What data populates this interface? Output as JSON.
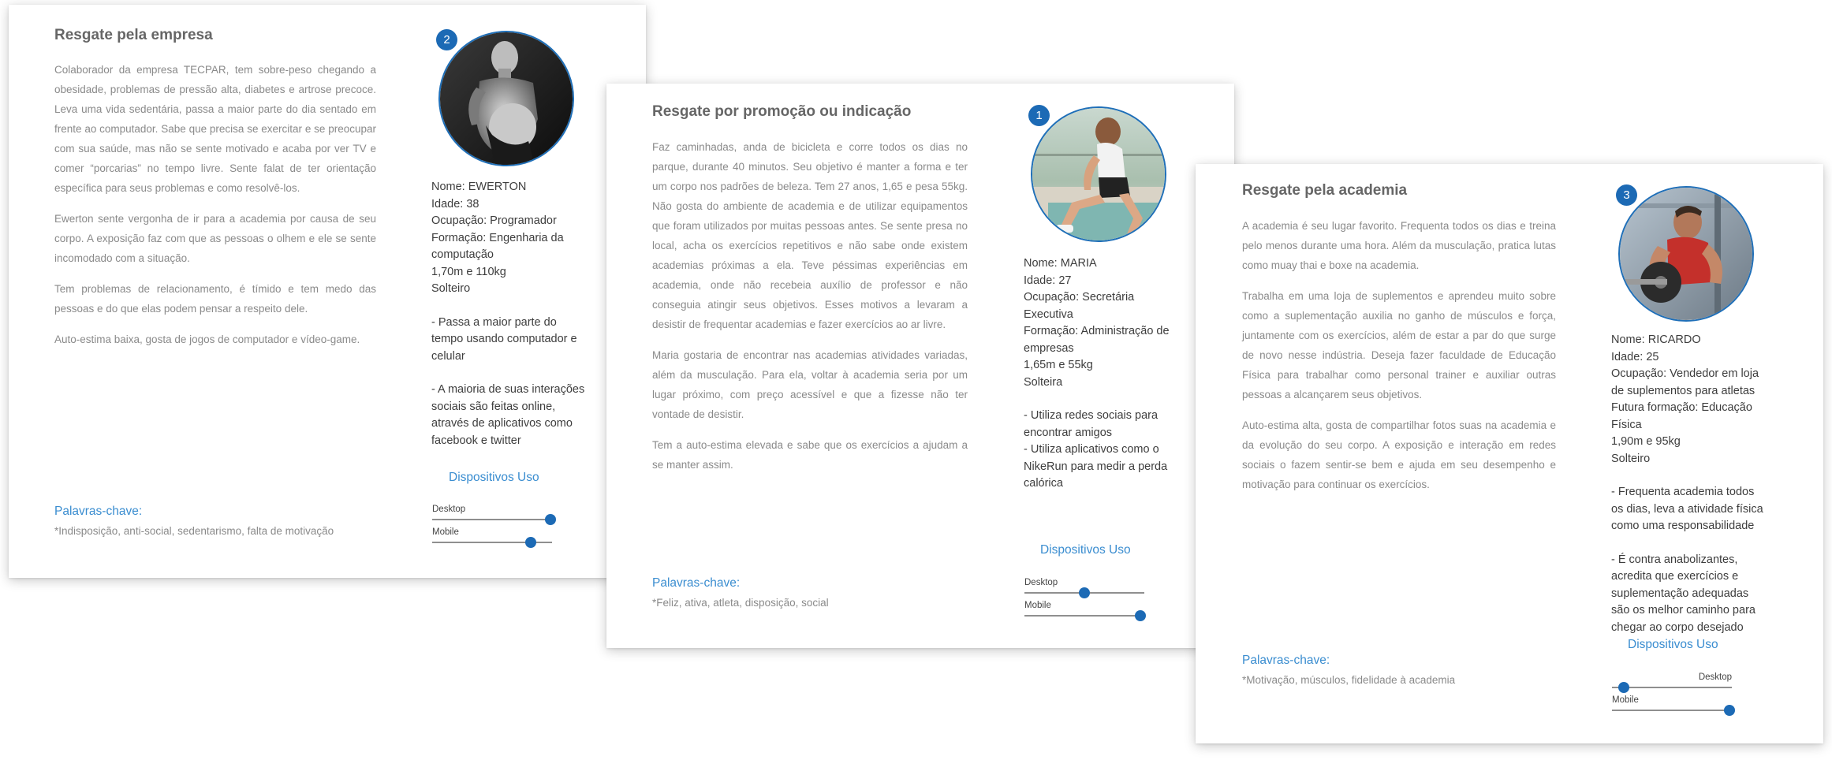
{
  "cards": [
    {
      "badge": "2",
      "title": "Resgate pela empresa",
      "paragraphs": [
        "Colaborador da empresa TECPAR, tem sobre-peso chegando a obesidade, problemas de pressão alta, diabetes e artrose precoce. Leva uma vida sedentária, passa a maior parte do dia sentado em frente ao computador. Sabe que precisa se exercitar e se preocupar com sua saúde, mas não se sente motivado e acaba por ver TV e comer “porcarias” no tempo livre. Sente falat de ter orientação específica para seus problemas e como resolvê-los.",
        "Ewerton sente vergonha de ir para a academia por causa de seu corpo. A exposição faz com que as pessoas o olhem e ele se sente incomodado com a situação.",
        "Tem problemas de relacionamento, é tímido e tem medo das pessoas e do que elas podem pensar a respeito dele.",
        "Auto-estima baixa, gosta de jogos de computador e vídeo-game."
      ],
      "info": {
        "name": "Nome: EWERTON",
        "age": "Idade: 38",
        "occupation": "Ocupação: Programador",
        "education": "Formação: Engenharia da computação",
        "body": "1,70m e 110kg",
        "status": "Solteiro",
        "notes": [
          "- Passa a maior parte do tempo usando computador e celular",
          "- A maioria de suas interações sociais são feitas online, através de aplicativos como facebook e twitter"
        ]
      },
      "devices_title": "Dispositivos Uso",
      "devices": [
        {
          "label": "Desktop",
          "level": 0.99
        },
        {
          "label": "Mobile",
          "level": 0.82
        }
      ],
      "keywords_label": "Palavras-chave:",
      "keywords": "*Indisposição, anti-social, sedentarismo, falta de motivação"
    },
    {
      "badge": "1",
      "title": "Resgate por promoção ou indicação",
      "paragraphs": [
        "Faz caminhadas, anda de bicicleta e corre todos os dias no parque, durante 40 minutos. Seu objetivo é manter a forma e ter um corpo nos padrões de beleza. Tem 27 anos, 1,65 e pesa 55kg. Não gosta do ambiente de academia e de utilizar equipamentos que foram utilizados por muitas pessoas antes. Se sente presa no local, acha os exercícios repetitivos e não sabe onde existem academias próximas a ela. Teve péssimas experiências em academia, onde não recebeia auxílio de professor e não conseguia atingir seus objetivos. Esses motivos a levaram a desistir de frequentar academias e fazer exercícios ao ar livre.",
        "Maria gostaria de encontrar nas academias atividades variadas, além da musculação. Para ela, voltar à academia seria por um lugar próximo, com preço acessível e que a fizesse não ter vontade de desistir.",
        "Tem a auto-estima elevada e sabe que os exercícios a ajudam a se manter assim."
      ],
      "info": {
        "name": "Nome: MARIA",
        "age": "Idade: 27",
        "occupation": "Ocupação: Secretária Executiva",
        "education": "Formação: Administração de empresas",
        "body": "1,65m e 55kg",
        "status": "Solteira",
        "notes": [
          "- Utiliza redes sociais para encontrar amigos",
          "- Utiliza aplicativos como o NikeRun para medir a perda calórica"
        ]
      },
      "devices_title": "Dispositivos Uso",
      "devices": [
        {
          "label": "Desktop",
          "level": 0.5
        },
        {
          "label": "Mobile",
          "level": 0.97
        }
      ],
      "keywords_label": "Palavras-chave:",
      "keywords": "*Feliz, ativa, atleta, disposição, social"
    },
    {
      "badge": "3",
      "title": "Resgate pela academia",
      "paragraphs": [
        "A academia é seu lugar favorito. Frequenta todos os dias e treina pelo menos durante uma hora. Além da musculação, pratica lutas como muay thai e boxe na academia.",
        "Trabalha em uma loja de suplementos e aprendeu muito sobre como a suplementação auxilia no ganho de músculos e força, juntamente com os exercícios, além de estar a par do que surge de novo nesse indústria. Deseja fazer faculdade de Educação Física para trabalhar como personal trainer e auxiliar outras pessoas a alcançarem seus objetivos.",
        "Auto-estima alta, gosta de compartilhar fotos suas na academia e da evolução do seu corpo. A exposição e interação em redes sociais o fazem sentir-se bem e ajuda em seu desempenho e motivação para continuar os exercícios."
      ],
      "info": {
        "name": "Nome: RICARDO",
        "age": "Idade: 25",
        "occupation": "Ocupação: Vendedor em loja de suplementos para atletas",
        "education": "Futura formação: Educação Física",
        "body": "1,90m e 95kg",
        "status": "Solteiro",
        "notes": [
          "- Frequenta academia todos os dias, leva a atividade física como uma responsabilidade",
          "- É contra anabolizantes, acredita que exercícios e suplementação adequadas são os melhor caminho para chegar ao corpo desejado"
        ]
      },
      "devices_title": "Dispositivos Uso",
      "devices": [
        {
          "label": "Desktop",
          "level": 0.1
        },
        {
          "label": "Mobile",
          "level": 0.98
        }
      ],
      "keywords_label": "Palavras-chave:",
      "keywords": "*Motivação, músculos, fidelidade à academia"
    }
  ]
}
